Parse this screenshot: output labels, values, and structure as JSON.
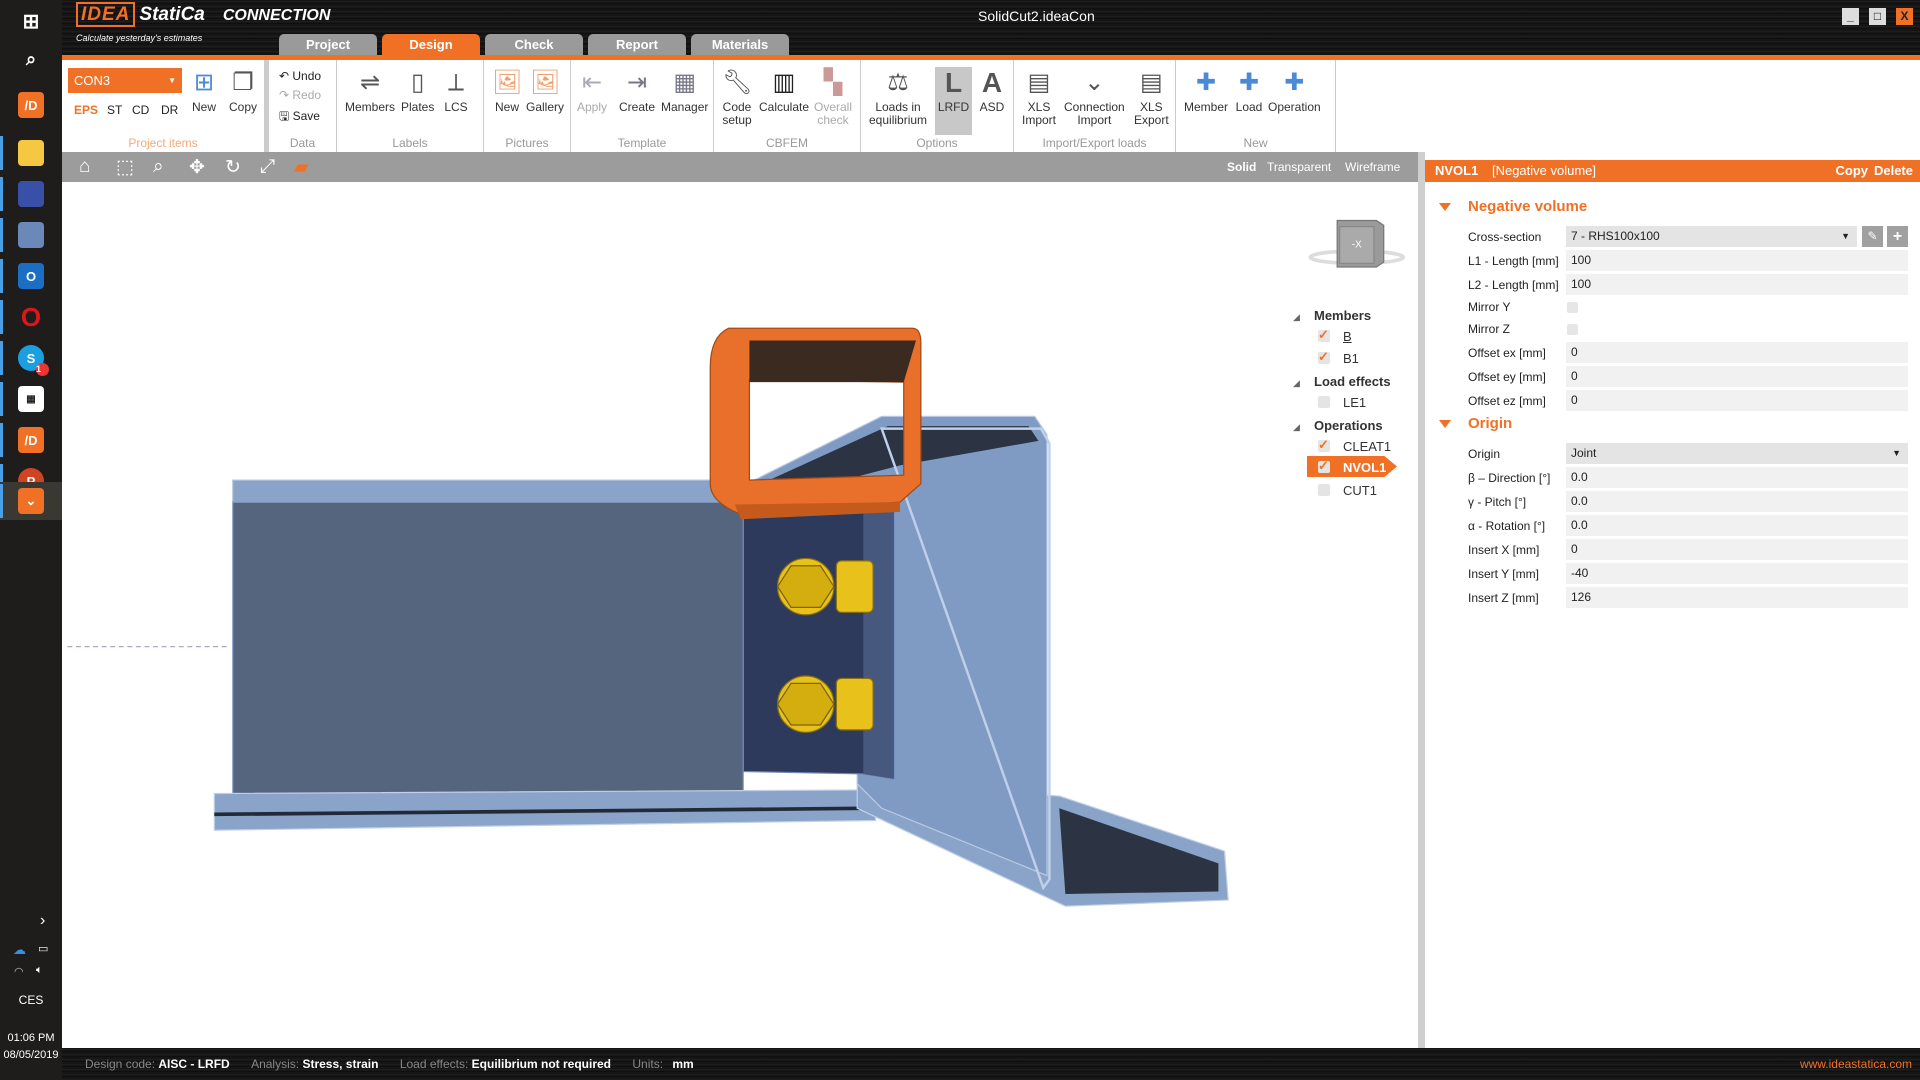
{
  "window": {
    "title": "SolidCut2.ideaCon",
    "app_name": "StatiCa",
    "app_brand": "IDEA",
    "app_module": "CONNECTION",
    "tagline": "Calculate yesterday's estimates",
    "website": "www.ideastatica.com"
  },
  "tabs": [
    {
      "label": "Project"
    },
    {
      "label": "Design",
      "active": true
    },
    {
      "label": "Check"
    },
    {
      "label": "Report"
    },
    {
      "label": "Materials"
    }
  ],
  "ribbon": {
    "project_items": {
      "name": "Project items",
      "selector_value": "CON3",
      "sub_tabs": [
        "EPS",
        "ST",
        "CD",
        "DR"
      ],
      "new": "New",
      "copy": "Copy"
    },
    "data": {
      "name": "Data",
      "undo": "Undo",
      "redo": "Redo",
      "save": "Save"
    },
    "labels": {
      "name": "Labels",
      "members": "Members",
      "plates": "Plates",
      "lcs": "LCS"
    },
    "pictures": {
      "name": "Pictures",
      "new": "New",
      "gallery": "Gallery"
    },
    "template": {
      "name": "Template",
      "apply": "Apply",
      "create": "Create",
      "manager": "Manager"
    },
    "cbfem": {
      "name": "CBFEM",
      "code_setup": [
        "Code",
        "setup"
      ],
      "calculate": "Calculate",
      "overall_check": [
        "Overall",
        "check"
      ]
    },
    "options": {
      "name": "Options",
      "loads": [
        "Loads in",
        "equilibrium"
      ],
      "lrfd": "LRFD",
      "asd": "ASD"
    },
    "import_export": {
      "name": "Import/Export loads",
      "xls_import": [
        "XLS",
        "Import"
      ],
      "connection_import": [
        "Connection",
        "Import"
      ],
      "xls_export": [
        "XLS",
        "Export"
      ]
    },
    "new": {
      "name": "New",
      "member": "Member",
      "load": "Load",
      "operation": "Operation"
    }
  },
  "view_modes": {
    "solid": "Solid",
    "transparent": "Transparent",
    "wireframe": "Wireframe",
    "active": "Solid"
  },
  "view_cube_label": "-X",
  "tree": {
    "members": {
      "label": "Members",
      "items": [
        {
          "label": "B",
          "checked": true
        },
        {
          "label": "B1",
          "checked": true
        }
      ]
    },
    "load_effects": {
      "label": "Load effects",
      "items": [
        {
          "label": "LE1",
          "checked": false
        }
      ]
    },
    "operations": {
      "label": "Operations",
      "items": [
        {
          "label": "CLEAT1",
          "checked": true
        },
        {
          "label": "NVOL1",
          "checked": true,
          "selected": true
        },
        {
          "label": "CUT1",
          "checked": false
        }
      ]
    }
  },
  "panel": {
    "id": "NVOL1",
    "type": "[Negative volume]",
    "copy": "Copy",
    "delete": "Delete",
    "section1": {
      "title": "Negative volume",
      "cross_section": {
        "label": "Cross-section",
        "value": "7 - RHS100x100"
      },
      "l1": {
        "label": "L1 - Length [mm]",
        "value": "100"
      },
      "l2": {
        "label": "L2 - Length [mm]",
        "value": "100"
      },
      "mirror_y": {
        "label": "Mirror Y",
        "checked": false
      },
      "mirror_z": {
        "label": "Mirror Z",
        "checked": false
      },
      "ex": {
        "label": "Offset ex [mm]",
        "value": "0"
      },
      "ey": {
        "label": "Offset ey [mm]",
        "value": "0"
      },
      "ez": {
        "label": "Offset ez [mm]",
        "value": "0"
      }
    },
    "section2": {
      "title": "Origin",
      "origin": {
        "label": "Origin",
        "value": "Joint"
      },
      "beta": {
        "label": "β – Direction [°]",
        "value": "0.0"
      },
      "gamma": {
        "label": "γ - Pitch [°]",
        "value": "0.0"
      },
      "alpha": {
        "label": "α - Rotation [°]",
        "value": "0.0"
      },
      "ix": {
        "label": "Insert X [mm]",
        "value": "0"
      },
      "iy": {
        "label": "Insert Y [mm]",
        "value": "-40"
      },
      "iz": {
        "label": "Insert Z [mm]",
        "value": "126"
      }
    }
  },
  "status": {
    "design_code_label": "Design code:",
    "design_code": "AISC - LRFD",
    "analysis_label": "Analysis:",
    "analysis": "Stress, strain",
    "load_effects_label": "Load effects:",
    "load_effects": "Equilibrium not required",
    "units_label": "Units:",
    "units": "mm"
  },
  "system_tray": {
    "language": "CES",
    "time": "01:06 PM",
    "date": "08/05/2019",
    "skype_badge": "1"
  },
  "colors": {
    "accent": "#f07126",
    "member": "#7f9bc4",
    "beam_web": "#55657e",
    "plate": "#2d3a5c",
    "bolt": "#e8c21a"
  }
}
